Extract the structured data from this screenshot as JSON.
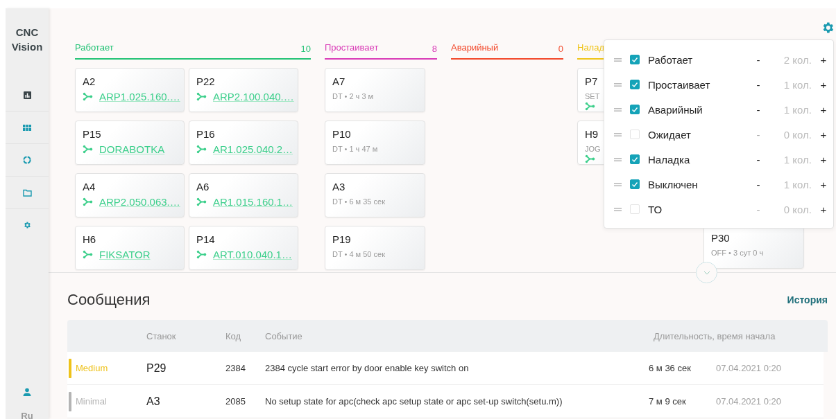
{
  "sidebar": {
    "logo": "CNC Vision",
    "language": "Ru"
  },
  "board": {
    "columns": [
      {
        "title": "Работает",
        "count": "10",
        "color": "#22c275",
        "cards": [
          {
            "name": "A2",
            "linked": true,
            "program": "ARP1.025.160.…"
          },
          {
            "name": "P22",
            "linked": true,
            "program": "ARP2.100.040.…"
          },
          {
            "name": "P15",
            "linked": true,
            "program": "DORABOTKA"
          },
          {
            "name": "P16",
            "linked": true,
            "program": "AR1.025.040.2…"
          },
          {
            "name": "A4",
            "linked": true,
            "program": "ARP2.050.063.…"
          },
          {
            "name": "A6",
            "linked": true,
            "program": "AR1.015.160.1…"
          },
          {
            "name": "H6",
            "linked": true,
            "program": "FIKSATOR"
          },
          {
            "name": "P14",
            "linked": true,
            "program": "ART.010.040.1…"
          }
        ]
      },
      {
        "title": "Простаивает",
        "count": "8",
        "color": "#d93bb7",
        "cards": [
          {
            "name": "A7",
            "linked": false,
            "status": "DT • 2 ч 3 м"
          },
          {
            "name": "P10",
            "linked": false,
            "status": "DT • 1 ч 47 м"
          },
          {
            "name": "A3",
            "linked": false,
            "status": "DT • 6 м 35 сек"
          },
          {
            "name": "P19",
            "linked": false,
            "status": "DT • 4 м 50 сек"
          }
        ]
      },
      {
        "title": "Аварийный",
        "count": "0",
        "color": "#f2482a"
      },
      {
        "title": "Налад",
        "color": "#efc418",
        "cards": [
          {
            "name": "P7",
            "linked": true,
            "status": "SET"
          },
          {
            "name": "H9",
            "linked": true,
            "status": "JOG"
          }
        ]
      },
      {
        "cards": [
          {
            "name": "P30",
            "linked": false,
            "status": "OFF • 3 сут 0 ч"
          }
        ]
      }
    ]
  },
  "column_settings": {
    "items": [
      {
        "label": "Работает",
        "checked": true,
        "decrement": "-",
        "decrement_disabled": false,
        "count": "2 кол.",
        "increment": "+"
      },
      {
        "label": "Простаивает",
        "checked": true,
        "decrement": "-",
        "decrement_disabled": false,
        "count": "1 кол.",
        "increment": "+"
      },
      {
        "label": "Аварийный",
        "checked": true,
        "decrement": "-",
        "decrement_disabled": false,
        "count": "1 кол.",
        "increment": "+"
      },
      {
        "label": "Ожидает",
        "checked": false,
        "decrement": "-",
        "decrement_disabled": true,
        "count": "0 кол.",
        "increment": "+"
      },
      {
        "label": "Наладка",
        "checked": true,
        "decrement": "-",
        "decrement_disabled": false,
        "count": "1 кол.",
        "increment": "+"
      },
      {
        "label": "Выключен",
        "checked": true,
        "decrement": "-",
        "decrement_disabled": false,
        "count": "1 кол.",
        "increment": "+"
      },
      {
        "label": "ТО",
        "checked": false,
        "decrement": "-",
        "decrement_disabled": true,
        "count": "0 кол.",
        "increment": "+"
      }
    ]
  },
  "messages": {
    "title": "Сообщения",
    "history_link": "История",
    "table": {
      "columns": [
        "Станок",
        "Код",
        "Событие",
        "Длительность, время начала"
      ],
      "rows": [
        {
          "severity": "Medium",
          "color": "#eec21b",
          "machine": "P29",
          "code": "2384",
          "event": "2384 cycle start error by door enable key switch on",
          "duration": "6 м 36 сек",
          "start": "07.04.2021 0:20"
        },
        {
          "severity": "Minimal",
          "color": "#b4b4b4",
          "machine": "A3",
          "code": "2085",
          "event": "No setup state for apc(check apc setup state or apc set-up switch(setu.m))",
          "duration": "7 м 9 сек",
          "start": "07.04.2021 0:20"
        }
      ]
    }
  }
}
